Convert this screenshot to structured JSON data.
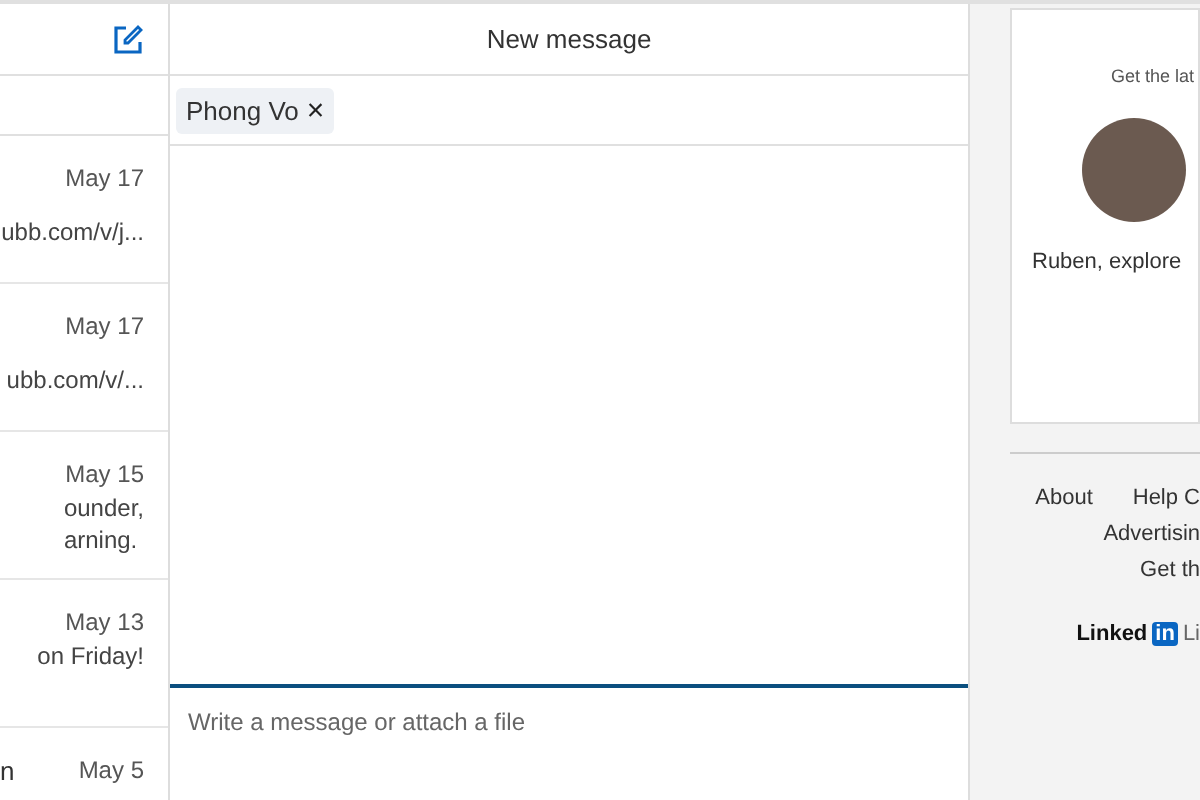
{
  "conversations": [
    {
      "date": "May 17",
      "snippet": [
        "ubb.com/v/j..."
      ]
    },
    {
      "date": "May 17",
      "snippet": [
        "ubb.com/v/..."
      ]
    },
    {
      "date": "May 15",
      "snippet": [
        "ounder,",
        "arning."
      ]
    },
    {
      "date": "May 13",
      "snippet": [
        "on Friday!"
      ]
    },
    {
      "name": "n",
      "date": "May 5"
    }
  ],
  "compose": {
    "title": "New message",
    "recipients": [
      {
        "name": "Phong Vo",
        "remove": "×"
      }
    ],
    "message": {
      "placeholder": "Write a message or attach a file"
    }
  },
  "promo": {
    "heading": "Get the lat",
    "text": "Ruben, explore"
  },
  "footer": {
    "links": [
      [
        "About",
        "Help C"
      ],
      [
        "Advertisin"
      ],
      [
        "Get th"
      ]
    ],
    "brand": {
      "word": "Linked",
      "mark": "in",
      "tail": "Li"
    }
  }
}
